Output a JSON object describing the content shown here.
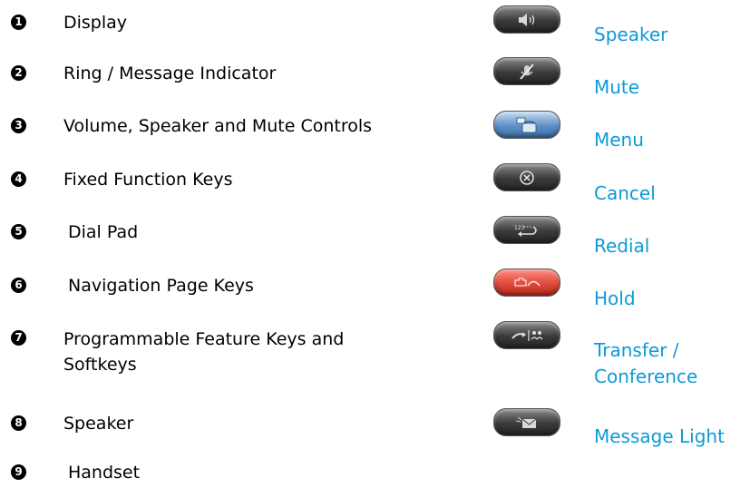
{
  "components": {
    "items": [
      {
        "number": "1",
        "label": "Display"
      },
      {
        "number": "2",
        "label": "Ring / Message Indicator"
      },
      {
        "number": "3",
        "label": "Volume, Speaker and Mute Controls"
      },
      {
        "number": "4",
        "label": "Fixed Function Keys"
      },
      {
        "number": "5",
        "label": "Dial Pad"
      },
      {
        "number": "6",
        "label": "Navigation Page Keys"
      },
      {
        "number": "7",
        "label": "Programmable Feature Keys and Softkeys"
      },
      {
        "number": "8",
        "label": "Speaker"
      },
      {
        "number": "9",
        "label": "Handset"
      }
    ]
  },
  "keys": {
    "items": [
      {
        "label": "Speaker",
        "icon": "speaker-icon",
        "style": "gray"
      },
      {
        "label": "Mute",
        "icon": "mute-icon",
        "style": "gray"
      },
      {
        "label": "Menu",
        "icon": "menu-phone-icon",
        "style": "blue"
      },
      {
        "label": "Cancel",
        "icon": "cancel-icon",
        "style": "gray"
      },
      {
        "label": "Redial",
        "icon": "redial-icon",
        "style": "gray"
      },
      {
        "label": "Hold",
        "icon": "hold-icon",
        "style": "red"
      },
      {
        "label": "Transfer / Conference",
        "icon": "transfer-conference-icon",
        "style": "gray"
      },
      {
        "label": "Message Light",
        "icon": "message-envelope-icon",
        "style": "gray"
      }
    ]
  },
  "colors": {
    "key_label": "#0c9ad8",
    "hold_key": "#e04a3c",
    "menu_key": "#5d8fc8",
    "gray_key": "#3a3a3a"
  }
}
